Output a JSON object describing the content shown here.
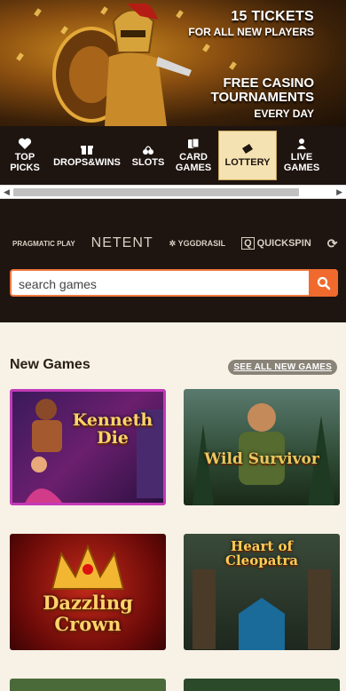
{
  "hero": {
    "line1": "15 TICKETS",
    "line2": "FOR ALL NEW PLAYERS",
    "line3": "FREE CASINO TOURNAMENTS",
    "line4": "EVERY DAY"
  },
  "categories": [
    {
      "label": "TOP PICKS",
      "icon": "heart-icon"
    },
    {
      "label": "DROPS&WINS",
      "icon": "gift-icon"
    },
    {
      "label": "SLOTS",
      "icon": "cherries-icon"
    },
    {
      "label": "CARD GAMES",
      "icon": "cards-icon"
    },
    {
      "label": "LOTTERY",
      "icon": "ticket-icon",
      "active": true
    },
    {
      "label": "LIVE GAMES",
      "icon": "dealer-icon"
    }
  ],
  "providers": [
    "PRAGMATIC PLAY",
    "NETENT",
    "YGGDRASIL",
    "QUICKSPIN"
  ],
  "search": {
    "placeholder": "search games"
  },
  "new_games": {
    "title": "New Games",
    "see_all": "SEE ALL NEW GAMES",
    "tiles": [
      {
        "name": "Kenneth Die"
      },
      {
        "name": "Wild Survivor"
      },
      {
        "name": "Dazzling Crown"
      },
      {
        "name": "Heart of Cleopatra"
      }
    ]
  },
  "colors": {
    "accent": "#f06a2e",
    "nav_bg": "#1e1410",
    "active_tab": "#f4e2b2",
    "page_bg": "#f7f1e6"
  }
}
